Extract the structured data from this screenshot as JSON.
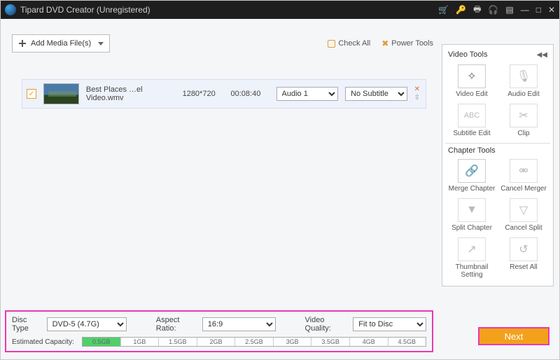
{
  "titlebar": {
    "title": "Tipard DVD Creator (Unregistered)"
  },
  "toolbar": {
    "add_media_label": "Add Media File(s)",
    "check_all_label": "Check All",
    "power_tools_label": "Power Tools"
  },
  "media": {
    "items": [
      {
        "filename": "Best Places …el Video.wmv",
        "resolution": "1280*720",
        "duration": "00:08:40",
        "audio_selected": "Audio 1",
        "subtitle_selected": "No Subtitle"
      }
    ]
  },
  "video_tools": {
    "header": "Video Tools",
    "tools": [
      {
        "name": "video-edit",
        "label": "Video Edit",
        "glyph": "✧",
        "disabled": false
      },
      {
        "name": "audio-edit",
        "label": "Audio Edit",
        "glyph": "🎙",
        "disabled": true
      },
      {
        "name": "subtitle-edit",
        "label": "Subtitle Edit",
        "glyph": "ABC",
        "disabled": true
      },
      {
        "name": "clip",
        "label": "Clip",
        "glyph": "✂",
        "disabled": true
      }
    ]
  },
  "chapter_tools": {
    "header": "Chapter Tools",
    "tools": [
      {
        "name": "merge-chapter",
        "label": "Merge Chapter",
        "glyph": "🔗",
        "disabled": false
      },
      {
        "name": "cancel-merger",
        "label": "Cancel Merger",
        "glyph": "⚮",
        "disabled": true
      },
      {
        "name": "split-chapter",
        "label": "Split Chapter",
        "glyph": "▼",
        "disabled": true
      },
      {
        "name": "cancel-split",
        "label": "Cancel Split",
        "glyph": "▽",
        "disabled": true
      },
      {
        "name": "thumbnail-setting",
        "label": "Thumbnail Setting",
        "glyph": "↗",
        "disabled": true
      },
      {
        "name": "reset-all",
        "label": "Reset All",
        "glyph": "↺",
        "disabled": true
      }
    ]
  },
  "bottom": {
    "disc_type_label": "Disc Type",
    "disc_type_value": "DVD-5 (4.7G)",
    "aspect_ratio_label": "Aspect Ratio:",
    "aspect_ratio_value": "16:9",
    "video_quality_label": "Video Quality:",
    "video_quality_value": "Fit to Disc",
    "capacity_label": "Estimated Capacity:",
    "capacity_fill_pct": 11,
    "ticks": [
      "0.5GB",
      "1GB",
      "1.5GB",
      "2GB",
      "2.5GB",
      "3GB",
      "3.5GB",
      "4GB",
      "4.5GB"
    ]
  },
  "next_label": "Next"
}
